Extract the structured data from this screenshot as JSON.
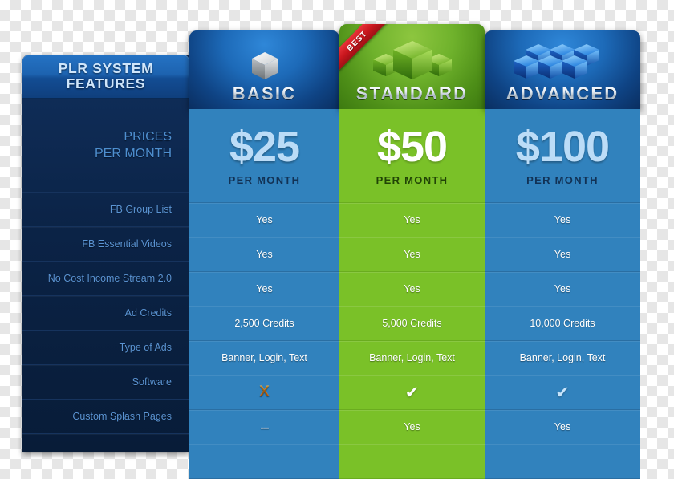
{
  "features_column": {
    "header_line1": "PLR SYSTEM",
    "header_line2": "FEATURES",
    "price_label_line1": "PRICES",
    "price_label_line2": "PER MONTH",
    "rows": [
      "FB Group List",
      "FB Essential Videos",
      "No Cost Income Stream 2.0",
      "Ad Credits",
      "Type of Ads",
      "Software",
      "Custom Splash Pages"
    ]
  },
  "plans": [
    {
      "id": "basic",
      "name": "BASIC",
      "icon": "single-gray-cube-icon",
      "price": "$25",
      "period": "PER MONTH",
      "accent": "#3182bd",
      "header_accent": "#1d6ab8",
      "badge": null,
      "values": [
        {
          "type": "text",
          "text": "Yes"
        },
        {
          "type": "text",
          "text": "Yes"
        },
        {
          "type": "text",
          "text": "Yes"
        },
        {
          "type": "text",
          "text": "2,500 Credits"
        },
        {
          "type": "text",
          "text": "Banner, Login, Text"
        },
        {
          "type": "x",
          "text": "X"
        },
        {
          "type": "dash",
          "text": "---"
        }
      ]
    },
    {
      "id": "standard",
      "name": "STANDARD",
      "icon": "triple-green-cube-icon",
      "price": "$50",
      "period": "PER MONTH",
      "accent": "#7ac128",
      "header_accent": "#6fb22c",
      "badge": "BEST",
      "values": [
        {
          "type": "text",
          "text": "Yes"
        },
        {
          "type": "text",
          "text": "Yes"
        },
        {
          "type": "text",
          "text": "Yes"
        },
        {
          "type": "text",
          "text": "5,000 Credits"
        },
        {
          "type": "text",
          "text": "Banner, Login, Text"
        },
        {
          "type": "check-white",
          "text": "✔"
        },
        {
          "type": "text",
          "text": "Yes"
        }
      ]
    },
    {
      "id": "advanced",
      "name": "ADVANCED",
      "icon": "multi-blue-cube-icon",
      "price": "$100",
      "period": "PER MONTH",
      "accent": "#3182bd",
      "header_accent": "#1d6ab8",
      "badge": null,
      "values": [
        {
          "type": "text",
          "text": "Yes"
        },
        {
          "type": "text",
          "text": "Yes"
        },
        {
          "type": "text",
          "text": "Yes"
        },
        {
          "type": "text",
          "text": "10,000 Credits"
        },
        {
          "type": "text",
          "text": "Banner, Login, Text"
        },
        {
          "type": "check-blue",
          "text": "✔"
        },
        {
          "type": "text",
          "text": "Yes"
        }
      ]
    }
  ]
}
